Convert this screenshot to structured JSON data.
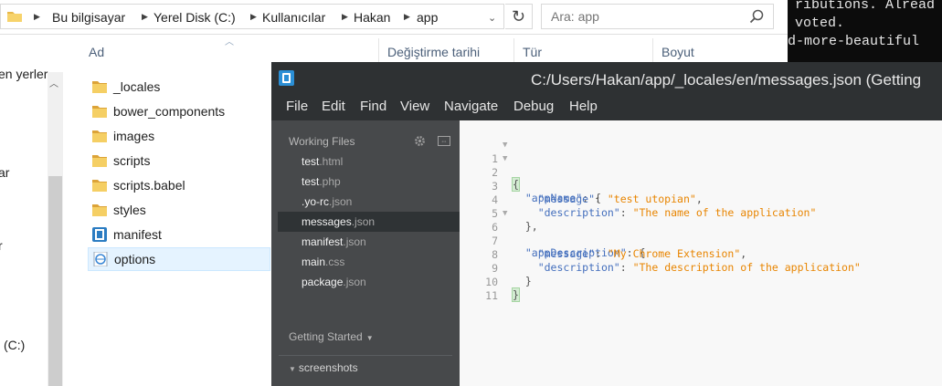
{
  "explorer": {
    "breadcrumbs": [
      "Bu bilgisayar",
      "Yerel Disk (C:)",
      "Kullanıcılar",
      "Hakan",
      "app"
    ],
    "search_placeholder": "Ara: app",
    "nav_items": [
      "en yerler",
      "ar",
      "r",
      "(C:)"
    ],
    "columns": [
      "Ad",
      "Değiştirme tarihi",
      "Tür",
      "Boyut"
    ],
    "files": [
      {
        "name": "_locales",
        "icon": "folder-icon"
      },
      {
        "name": "bower_components",
        "icon": "folder-icon"
      },
      {
        "name": "images",
        "icon": "folder-icon"
      },
      {
        "name": "scripts",
        "icon": "folder-icon"
      },
      {
        "name": "scripts.babel",
        "icon": "folder-icon"
      },
      {
        "name": "styles",
        "icon": "folder-icon"
      },
      {
        "name": "manifest",
        "icon": "brackets-file-icon"
      },
      {
        "name": "options",
        "icon": "html-file-icon"
      }
    ],
    "selected_file": "options"
  },
  "terminal": {
    "lines": [
      "ributions. Alread",
      " voted.",
      "d-more-beautiful"
    ]
  },
  "brackets": {
    "title": "C:/Users/Hakan/app/_locales/en/messages.json (Getting",
    "menu": [
      "File",
      "Edit",
      "Find",
      "View",
      "Navigate",
      "Debug",
      "Help"
    ],
    "working_files_label": "Working Files",
    "working_files": [
      {
        "base": "test",
        "ext": ".html"
      },
      {
        "base": "test",
        "ext": ".php"
      },
      {
        "base": ".yo-rc",
        "ext": ".json"
      },
      {
        "base": "messages",
        "ext": ".json"
      },
      {
        "base": "manifest",
        "ext": ".json"
      },
      {
        "base": "main",
        "ext": ".css"
      },
      {
        "base": "package",
        "ext": ".json"
      }
    ],
    "active_file": "messages.json",
    "project_label": "Getting Started",
    "tree_folder": "screenshots",
    "tree_child": "...",
    "code": {
      "line_numbers": [
        "1",
        "2",
        "3",
        "4",
        "5",
        "6",
        "7",
        "8",
        "9",
        "10",
        "11"
      ],
      "open_brace": "{",
      "close_brace": "}",
      "key_app_name": "\"appName\"",
      "key_message": "\"message\"",
      "key_description": "\"description\"",
      "key_app_description": "\"appDescription\"",
      "val_message_1": "\"test utopian\"",
      "val_description_1": "\"The name of the application\"",
      "val_message_2": "\"My Chrome Extension\"",
      "val_description_2": "\"The description of the application\""
    }
  },
  "colors": {
    "editor_dark": "#3c3f41",
    "sidebar": "#47494b",
    "code_key": "#446fbd",
    "code_string": "#e88501",
    "selection_blue": "#e5f3ff"
  }
}
